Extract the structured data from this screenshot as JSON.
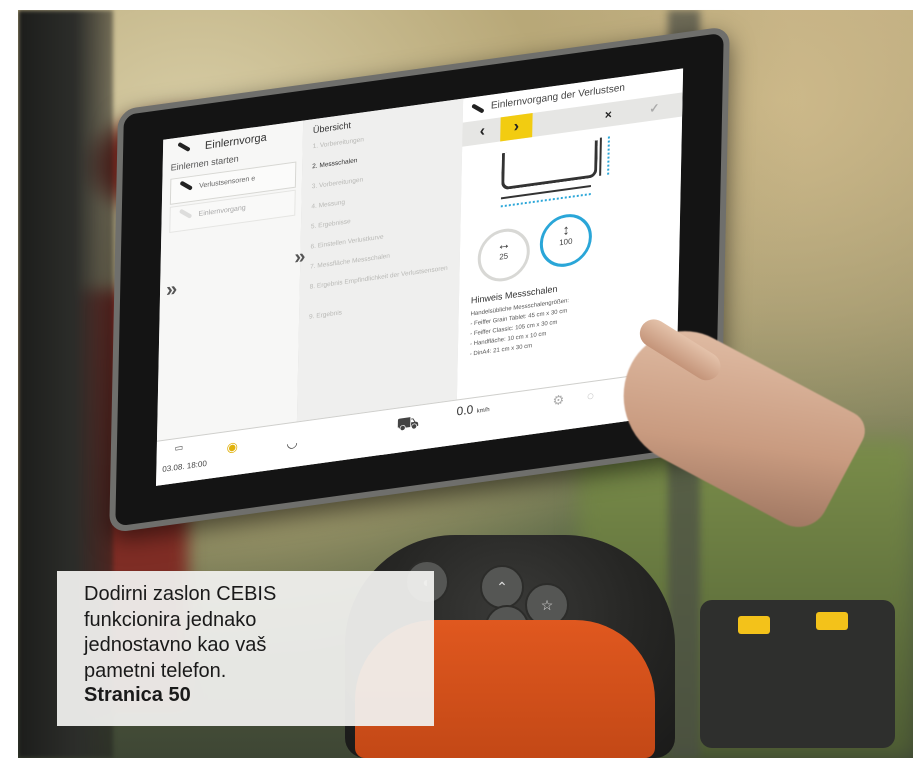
{
  "caption": {
    "text": "Dodirni zaslon CEBIS\nfunkcionira jednako\njednostavno kao vaš\npametni telefon.",
    "page_ref": "Stranica 50"
  },
  "screen": {
    "left_panel": {
      "title": "Einlernvorga",
      "subtitle": "Einlernen starten",
      "rows": [
        "Verlustsensoren e",
        "Einlernvorgang"
      ]
    },
    "middle_panel": {
      "title": "Übersicht",
      "items": [
        "1. Vorbereitungen",
        "2. Messschalen",
        "3. Vorbereitungen",
        "4. Messung",
        "5. Ergebnisse",
        "6. Einstellen Verlustkurve",
        "7. Messfläche Messschalen",
        "8. Ergebnis Empfindlichkeit der Verlustsensoren",
        "9. Ergebnis"
      ],
      "active_index": 1
    },
    "right_panel": {
      "title": "Einlernvorgang der Verlustsen",
      "nav": {
        "prev": "‹",
        "next": "›",
        "close": "×",
        "confirm": "✓"
      },
      "gauge_width": {
        "icon": "↔",
        "value": "25"
      },
      "gauge_height": {
        "icon": "↕",
        "value": "100"
      },
      "hint_title": "Hinweis Messschalen",
      "hint_lines": [
        "Handelsübliche Messschalengrößen:",
        "- Feiffer Grain Tablet: 45 cm x 30 cm",
        "- Feiffer Classic: 105 cm x 30 cm",
        "- Handfläche: 10 cm x 10 cm",
        "- DinA4: 21 cm x 30 cm"
      ]
    },
    "bottom_bar": {
      "date": "03.08.",
      "time": "18:00",
      "speed": "0.0",
      "speed_unit": "km/h",
      "star": "★"
    },
    "expand_arrows": "»",
    "accent_yellow": "#f2cc11",
    "accent_blue": "#2aa6d8"
  }
}
